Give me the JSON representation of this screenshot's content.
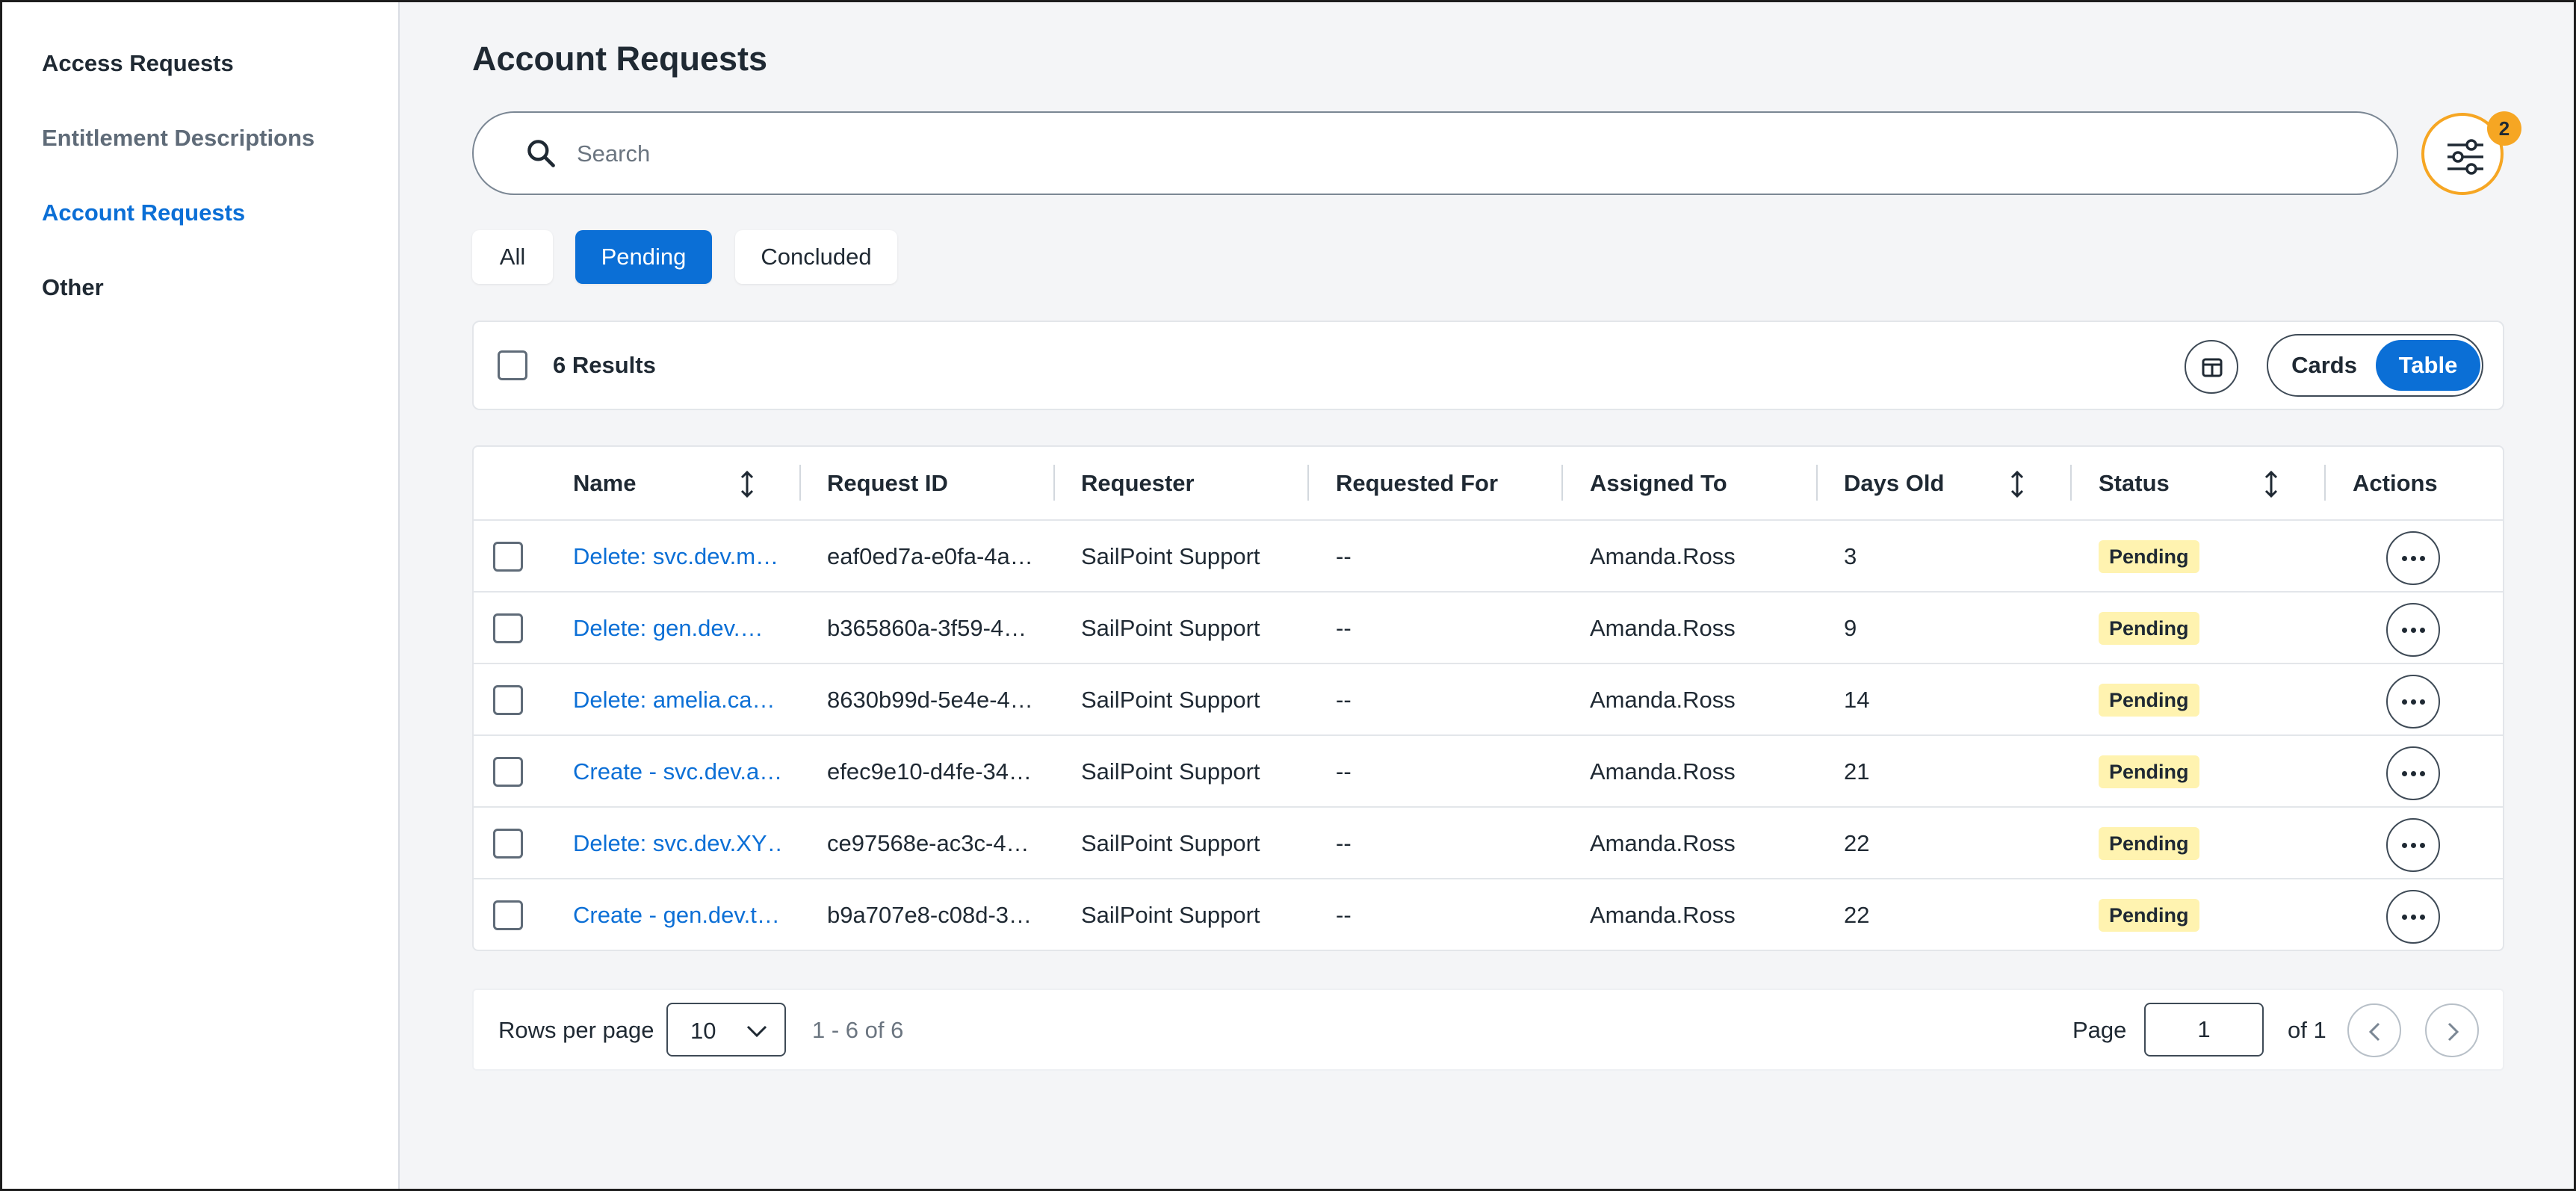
{
  "sidebar": {
    "items": [
      {
        "label": "Access Requests",
        "state": "default"
      },
      {
        "label": "Entitlement Descriptions",
        "state": "muted"
      },
      {
        "label": "Account Requests",
        "state": "active"
      },
      {
        "label": "Other",
        "state": "default"
      }
    ]
  },
  "main": {
    "title": "Account Requests",
    "search": {
      "placeholder": "Search",
      "value": ""
    },
    "filter": {
      "icon": "sliders-icon",
      "badge_count": "2"
    },
    "tabs": [
      {
        "label": "All",
        "active": false
      },
      {
        "label": "Pending",
        "active": true
      },
      {
        "label": "Concluded",
        "active": false
      }
    ],
    "results": {
      "label": "6 Results",
      "view_toggle": {
        "cards": "Cards",
        "table": "Table",
        "selected": "Table"
      }
    },
    "table": {
      "columns": [
        "Name",
        "Request ID",
        "Requester",
        "Requested For",
        "Assigned To",
        "Days Old",
        "Status",
        "Actions"
      ],
      "rows": [
        {
          "name": "Delete: svc.dev.m…",
          "request_id": "eaf0ed7a-e0fa-4a…",
          "requester": "SailPoint Support",
          "requested_for": "--",
          "assigned_to": "Amanda.Ross",
          "days_old": "3",
          "status": "Pending"
        },
        {
          "name": "Delete: gen.dev.…",
          "request_id": "b365860a-3f59-4…",
          "requester": "SailPoint Support",
          "requested_for": "--",
          "assigned_to": "Amanda.Ross",
          "days_old": "9",
          "status": "Pending"
        },
        {
          "name": "Delete: amelia.ca…",
          "request_id": "8630b99d-5e4e-4…",
          "requester": "SailPoint Support",
          "requested_for": "--",
          "assigned_to": "Amanda.Ross",
          "days_old": "14",
          "status": "Pending"
        },
        {
          "name": "Create - svc.dev.a…",
          "request_id": "efec9e10-d4fe-34…",
          "requester": "SailPoint Support",
          "requested_for": "--",
          "assigned_to": "Amanda.Ross",
          "days_old": "21",
          "status": "Pending"
        },
        {
          "name": "Delete: svc.dev.XY…",
          "request_id": "ce97568e-ac3c-4…",
          "requester": "SailPoint Support",
          "requested_for": "--",
          "assigned_to": "Amanda.Ross",
          "days_old": "22",
          "status": "Pending"
        },
        {
          "name": "Create - gen.dev.t…",
          "request_id": "b9a707e8-c08d-3…",
          "requester": "SailPoint Support",
          "requested_for": "--",
          "assigned_to": "Amanda.Ross",
          "days_old": "22",
          "status": "Pending"
        }
      ]
    },
    "pagination": {
      "rows_per_page_label": "Rows per page",
      "rows_per_page": "10",
      "range": "1 - 6 of 6",
      "page_label": "Page",
      "page": "1",
      "of_total": "of 1"
    }
  },
  "colors": {
    "accent": "#0b6fd6",
    "filter_ring": "#f6a623",
    "pending_badge": "#fff3b0"
  }
}
